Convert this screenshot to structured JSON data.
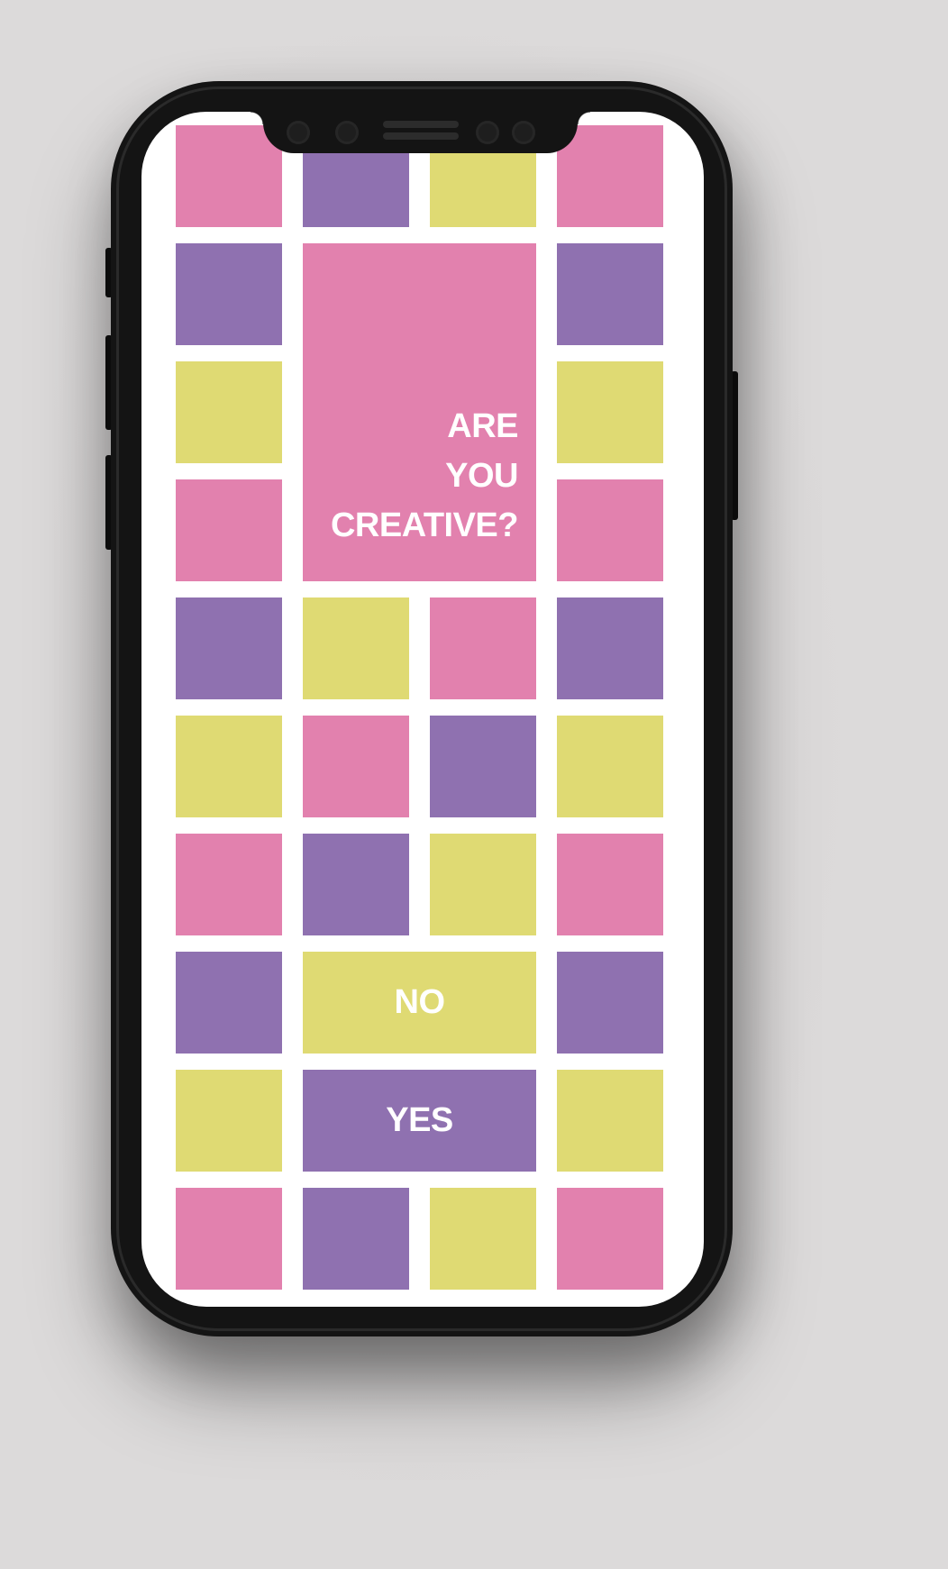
{
  "screen": {
    "headline": {
      "line1": "ARE",
      "line2": "YOU",
      "line3": "CREATIVE?"
    },
    "buttons": {
      "no_label": "NO",
      "yes_label": "YES"
    }
  },
  "colors": {
    "pink": "#e281ae",
    "purple": "#8f71b0",
    "yellow": "#dfda73",
    "screen_background": "#ffffff",
    "phone_frame": "#141414",
    "page_background": "#dcdada"
  }
}
